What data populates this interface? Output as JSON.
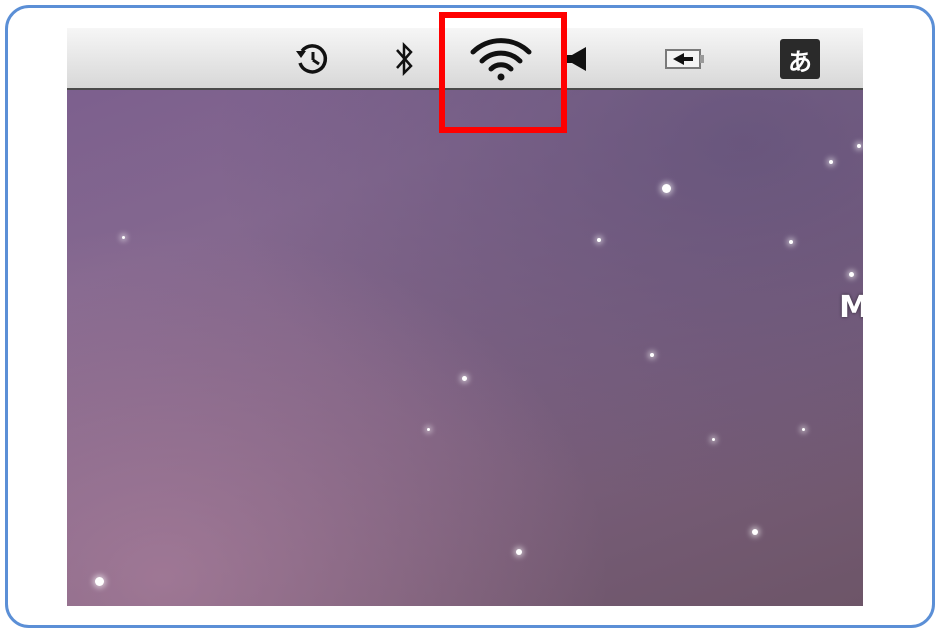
{
  "menubar": {
    "icons": [
      {
        "name": "time-machine-icon"
      },
      {
        "name": "bluetooth-icon"
      },
      {
        "name": "wifi-icon"
      },
      {
        "name": "volume-icon"
      },
      {
        "name": "battery-charging-icon"
      },
      {
        "name": "input-method-icon",
        "label": "あ"
      }
    ]
  },
  "desktop": {
    "partial_label": "M"
  },
  "highlight": {
    "target": "wifi-icon",
    "color": "#ff0000"
  },
  "colors": {
    "frame_border": "#5b8fd6",
    "menubar": "#e6e6e6",
    "wallpaper": "#7a5d8e"
  }
}
